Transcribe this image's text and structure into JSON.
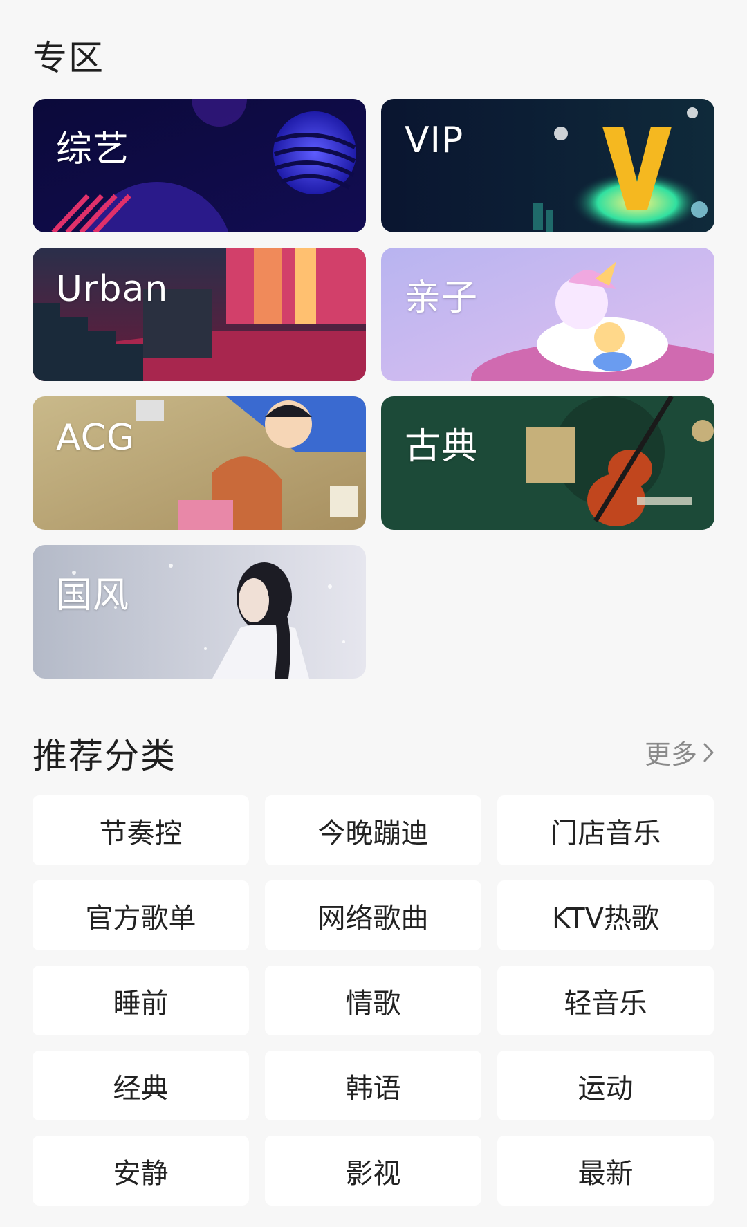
{
  "zone": {
    "title": "专区",
    "cards": [
      {
        "label": "综艺"
      },
      {
        "label": "VIP"
      },
      {
        "label": "Urban"
      },
      {
        "label": "亲子"
      },
      {
        "label": "ACG"
      },
      {
        "label": "古典"
      },
      {
        "label": "国风"
      }
    ]
  },
  "recommend": {
    "title": "推荐分类",
    "more_label": "更多",
    "more_icon": "chevron-right-icon",
    "categories": [
      "节奏控",
      "今晚蹦迪",
      "门店音乐",
      "官方歌单",
      "网络歌曲",
      "KTV热歌",
      "睡前",
      "情歌",
      "轻音乐",
      "经典",
      "韩语",
      "运动",
      "安静",
      "影视",
      "最新"
    ]
  },
  "colors": {
    "background": "#f7f7f7",
    "chip_background": "#ffffff",
    "more_text": "#8a8a8a"
  }
}
